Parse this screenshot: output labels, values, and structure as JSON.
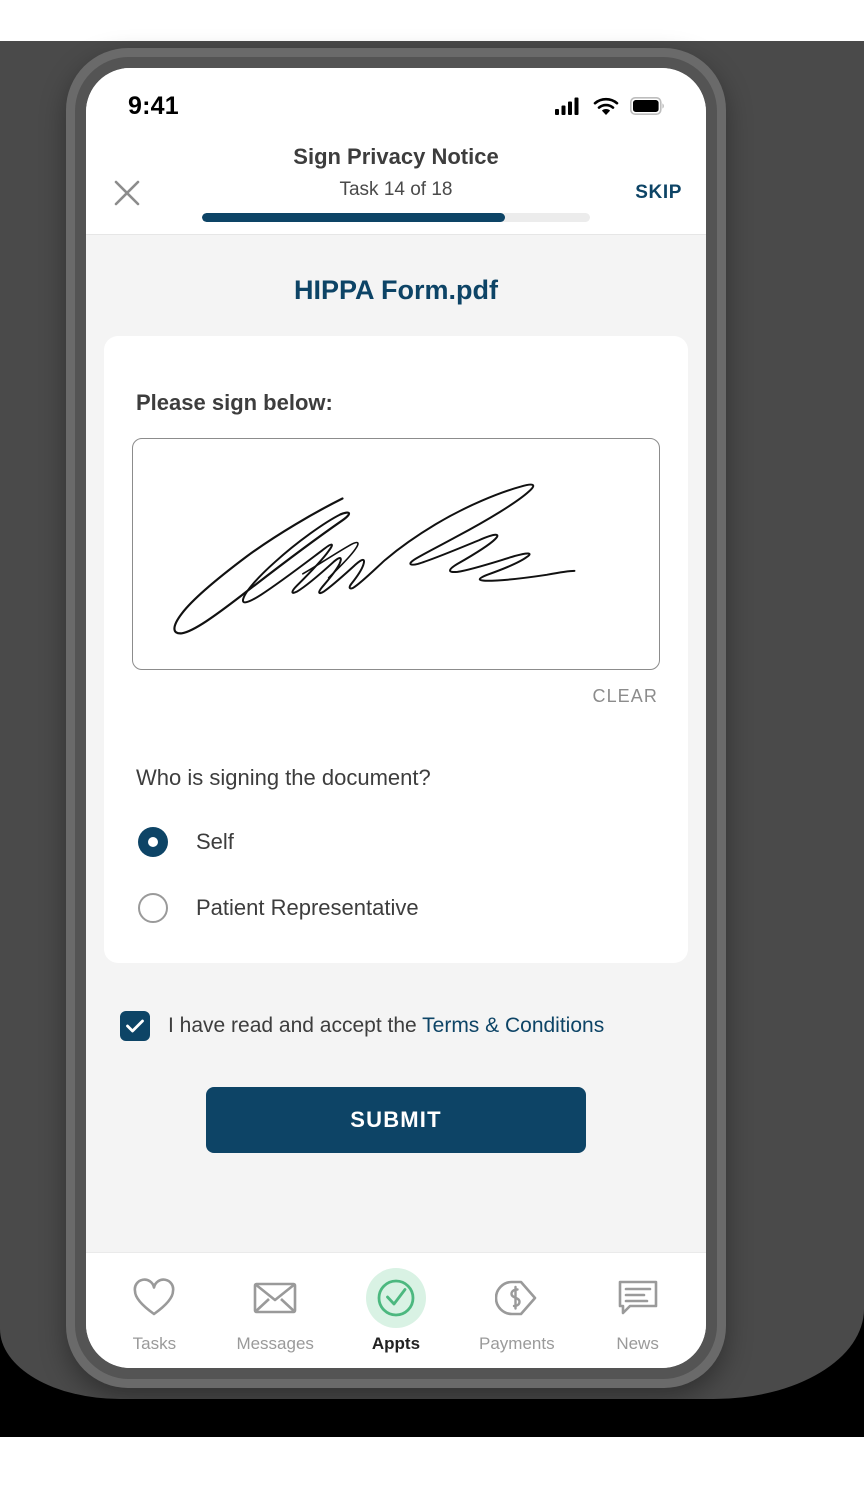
{
  "status_bar": {
    "time": "9:41",
    "signal_icon": "cellular-signal-icon",
    "wifi_icon": "wifi-icon",
    "battery_icon": "battery-full-icon"
  },
  "nav": {
    "close_icon": "close-icon",
    "title": "Sign Privacy Notice",
    "subtitle": "Task 14 of 18",
    "skip_label": "SKIP",
    "progress_percent": 78,
    "progress_fill_color": "#0d4466",
    "progress_track_color": "#ececec"
  },
  "main": {
    "document_title": "HIPPA Form.pdf",
    "document_title_color": "#0d4466",
    "sign_label": "Please sign below:",
    "signature_present": true,
    "clear_label": "CLEAR",
    "question": "Who is signing the document?",
    "radio_options": [
      {
        "label": "Self",
        "selected": true
      },
      {
        "label": "Patient Representative",
        "selected": false
      }
    ],
    "terms": {
      "checked": true,
      "text_before": "I have read and accept the ",
      "link_label": "Terms & Conditions"
    },
    "submit_label": "SUBMIT"
  },
  "tabbar": {
    "items": [
      {
        "label": "Tasks",
        "icon": "heart-icon",
        "active": false
      },
      {
        "label": "Messages",
        "icon": "envelope-icon",
        "active": false
      },
      {
        "label": "Appts",
        "icon": "check-circle-icon",
        "active": true
      },
      {
        "label": "Payments",
        "icon": "dollar-tag-icon",
        "active": false
      },
      {
        "label": "News",
        "icon": "news-chat-icon",
        "active": false
      }
    ],
    "active_bg_color": "#d9f2e4",
    "active_icon_color": "#4cb87f",
    "inactive_icon_color": "#9a9a9a"
  },
  "theme": {
    "accent": "#0d4466",
    "page_bg": "#f4f4f4",
    "card_bg": "#ffffff",
    "bezel": "#545454"
  }
}
